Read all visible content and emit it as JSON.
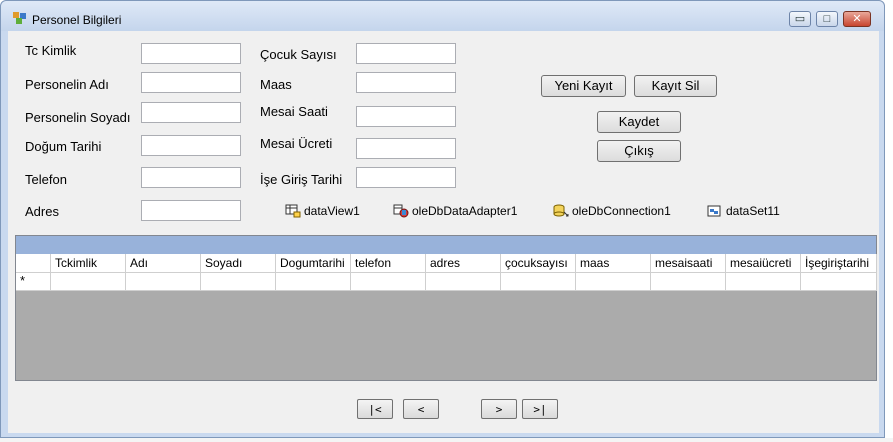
{
  "window": {
    "title": "Personel Bilgileri",
    "minimize_glyph": "▭",
    "maximize_glyph": "□",
    "close_glyph": "✕"
  },
  "form": {
    "tc_label": "Tc Kimlik",
    "ad_label": "Personelin Adı",
    "soyad_label": "Personelin Soyadı",
    "dogum_label": "Doğum Tarihi",
    "telefon_label": "Telefon",
    "adres_label": "Adres",
    "cocuk_label": "Çocuk Sayısı",
    "maas_label": "Maas",
    "mesai_saati_label": "Mesai Saati",
    "mesai_ucreti_label": "Mesai Ücreti",
    "ise_giris_label": "İşe Giriş Tarihi",
    "tc_value": "",
    "ad_value": "",
    "soyad_value": "",
    "dogum_value": "",
    "telefon_value": "",
    "adres_value": "",
    "cocuk_value": "",
    "maas_value": "",
    "mesai_saati_value": "",
    "mesai_ucreti_value": "",
    "ise_giris_value": ""
  },
  "buttons": {
    "yeni_kayit": "Yeni Kayıt",
    "kayit_sil": "Kayıt Sil",
    "kaydet": "Kaydet",
    "cikis": "Çıkış"
  },
  "tray": {
    "data_view": "dataView1",
    "adapter": "oleDbDataAdapter1",
    "connection": "oleDbConnection1",
    "dataset": "dataSet11"
  },
  "grid": {
    "columns": [
      "Tckimlik",
      "Adı",
      "Soyadı",
      "Dogumtarihi",
      "telefon",
      "adres",
      "çocuksayısı",
      "maas",
      "mesaisaati",
      "mesaiücreti",
      "İşegiriştarihi"
    ],
    "new_row_marker": "*",
    "caption_color": "#98b2da"
  },
  "nav": {
    "first": "|<",
    "prev": "<",
    "next": ">",
    "last": ">|"
  }
}
